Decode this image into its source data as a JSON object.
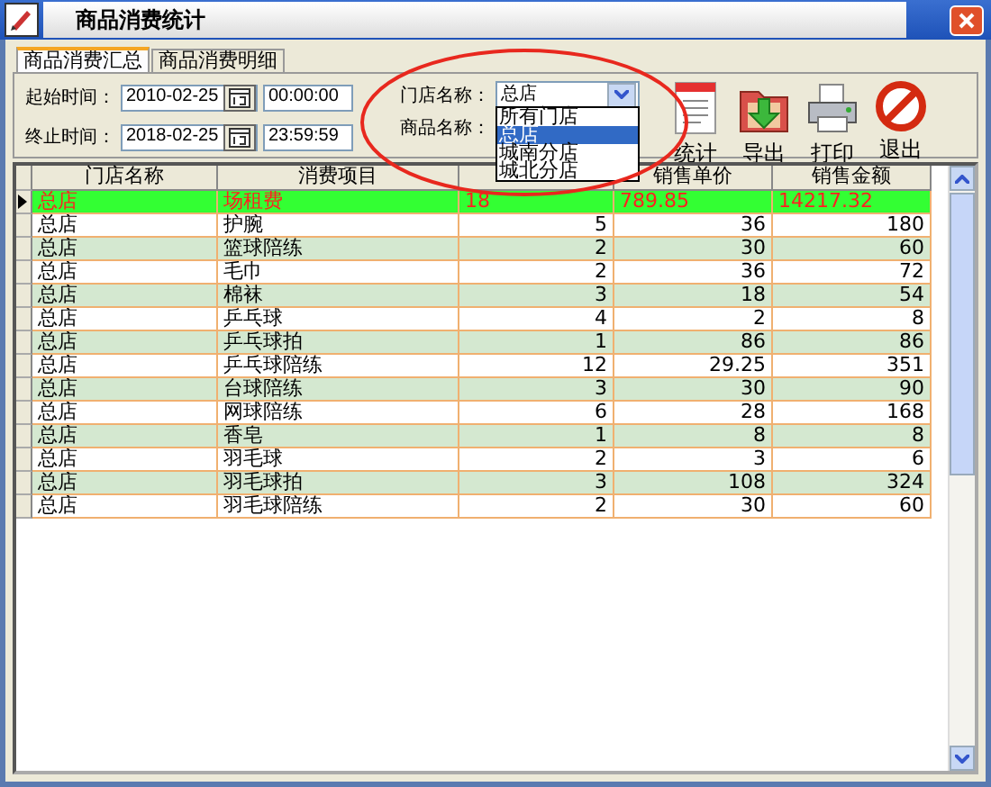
{
  "window": {
    "title": "商品消费统计"
  },
  "tabs": [
    {
      "label": "商品消费汇总",
      "selected": true
    },
    {
      "label": "商品消费明细",
      "selected": false
    }
  ],
  "filters": {
    "start_label": "起始时间：",
    "start_date": "2010-02-25",
    "start_time": "00:00:00",
    "end_label": "终止时间：",
    "end_date": "2018-02-25",
    "end_time": "23:59:59",
    "store_label": "门店名称：",
    "store_value": "总店",
    "product_label": "商品名称："
  },
  "store_dropdown": {
    "expanded": true,
    "options": [
      {
        "label": "所有门店",
        "selected": false
      },
      {
        "label": "总店",
        "selected": true
      },
      {
        "label": "城南分店",
        "selected": false
      },
      {
        "label": "城北分店",
        "selected": false
      }
    ]
  },
  "toolbar": [
    {
      "kind": "stats",
      "label": "统计"
    },
    {
      "kind": "export",
      "label": "导出"
    },
    {
      "kind": "print",
      "label": "打印"
    },
    {
      "kind": "exit",
      "label": "退出"
    }
  ],
  "table": {
    "columns": [
      {
        "label": "门店名称"
      },
      {
        "label": "消费项目"
      },
      {},
      {
        "label": "销售单价"
      },
      {
        "label": "销售金额"
      }
    ],
    "rows": [
      {
        "selected": true,
        "cells": [
          "总店",
          "场租费",
          "18",
          "789.85",
          "14217.32"
        ]
      },
      {
        "selected": false,
        "cells": [
          "总店",
          "护腕",
          "5",
          "36",
          "180"
        ]
      },
      {
        "selected": false,
        "cells": [
          "总店",
          "篮球陪练",
          "2",
          "30",
          "60"
        ]
      },
      {
        "selected": false,
        "cells": [
          "总店",
          "毛巾",
          "2",
          "36",
          "72"
        ]
      },
      {
        "selected": false,
        "cells": [
          "总店",
          "棉袜",
          "3",
          "18",
          "54"
        ]
      },
      {
        "selected": false,
        "cells": [
          "总店",
          "乒乓球",
          "4",
          "2",
          "8"
        ]
      },
      {
        "selected": false,
        "cells": [
          "总店",
          "乒乓球拍",
          "1",
          "86",
          "86"
        ]
      },
      {
        "selected": false,
        "cells": [
          "总店",
          "乒乓球陪练",
          "12",
          "29.25",
          "351"
        ]
      },
      {
        "selected": false,
        "cells": [
          "总店",
          "台球陪练",
          "3",
          "30",
          "90"
        ]
      },
      {
        "selected": false,
        "cells": [
          "总店",
          "网球陪练",
          "6",
          "28",
          "168"
        ]
      },
      {
        "selected": false,
        "cells": [
          "总店",
          "香皂",
          "1",
          "8",
          "8"
        ]
      },
      {
        "selected": false,
        "cells": [
          "总店",
          "羽毛球",
          "2",
          "3",
          "6"
        ]
      },
      {
        "selected": false,
        "cells": [
          "总店",
          "羽毛球拍",
          "3",
          "108",
          "324"
        ]
      },
      {
        "selected": false,
        "cells": [
          "总店",
          "羽毛球陪练",
          "2",
          "30",
          "60"
        ]
      }
    ]
  }
}
